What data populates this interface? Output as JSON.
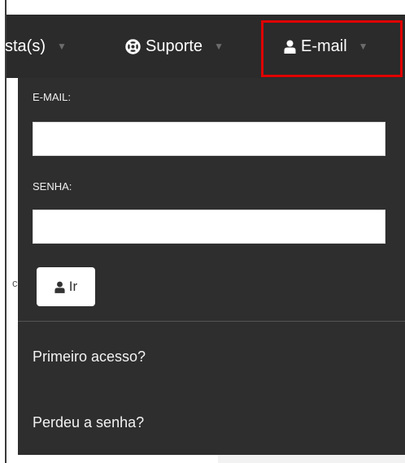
{
  "navbar": {
    "items": [
      {
        "label": "sta(s)",
        "icon": ""
      },
      {
        "label": "Suporte",
        "icon": "lifebuoy-icon"
      },
      {
        "label": "E-mail",
        "icon": "user-icon"
      }
    ],
    "caret_icon": "caret-down-icon",
    "selected_outline_color": "#e00000"
  },
  "login_dropdown": {
    "email_label": "E-MAIL:",
    "email_value": "",
    "password_label": "SENHA:",
    "password_value": "",
    "submit_label": "Ir",
    "submit_icon": "user-icon",
    "links": [
      "Primeiro acesso?",
      "Perdeu a senha?"
    ]
  },
  "page_fragment": "c",
  "colors": {
    "navbar_bg": "#2b2b2b",
    "dropdown_bg": "#2e2e2e",
    "text": "#ffffff"
  }
}
